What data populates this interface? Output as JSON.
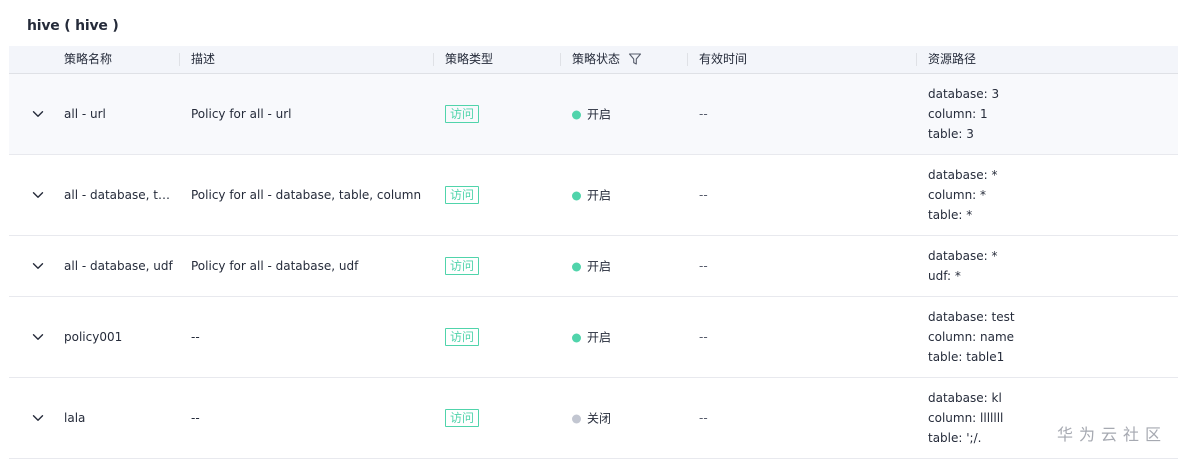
{
  "section_title": "hive ( hive )",
  "header": {
    "name": "策略名称",
    "desc": "描述",
    "type": "策略类型",
    "status": "策略状态",
    "time": "有效时间",
    "path": "资源路径"
  },
  "rows": [
    {
      "name": "all - url",
      "desc": "Policy for all - url",
      "type": "访问",
      "status": "开启",
      "status_on": true,
      "time": "--",
      "paths": [
        "database: 3",
        "column: 1",
        "table: 3"
      ]
    },
    {
      "name": "all - database, tabl...",
      "desc": "Policy for all - database, table, column",
      "type": "访问",
      "status": "开启",
      "status_on": true,
      "time": "--",
      "paths": [
        "database: *",
        "column: *",
        "table: *"
      ]
    },
    {
      "name": "all - database, udf",
      "desc": "Policy for all - database, udf",
      "type": "访问",
      "status": "开启",
      "status_on": true,
      "time": "--",
      "paths": [
        "database: *",
        "udf: *"
      ]
    },
    {
      "name": "policy001",
      "desc": "--",
      "type": "访问",
      "status": "开启",
      "status_on": true,
      "time": "--",
      "paths": [
        "database: test",
        "column: name",
        "table: table1"
      ]
    },
    {
      "name": "lala",
      "desc": "--",
      "type": "访问",
      "status": "关闭",
      "status_on": false,
      "time": "--",
      "paths": [
        "database: kl",
        "column: lllllll",
        "table: ';/."
      ]
    }
  ],
  "watermark": "华为云社区",
  "colors": {
    "status_on": "#50d4ab",
    "status_off": "#c2c6d1",
    "header_bg": "#f3f5fa"
  }
}
